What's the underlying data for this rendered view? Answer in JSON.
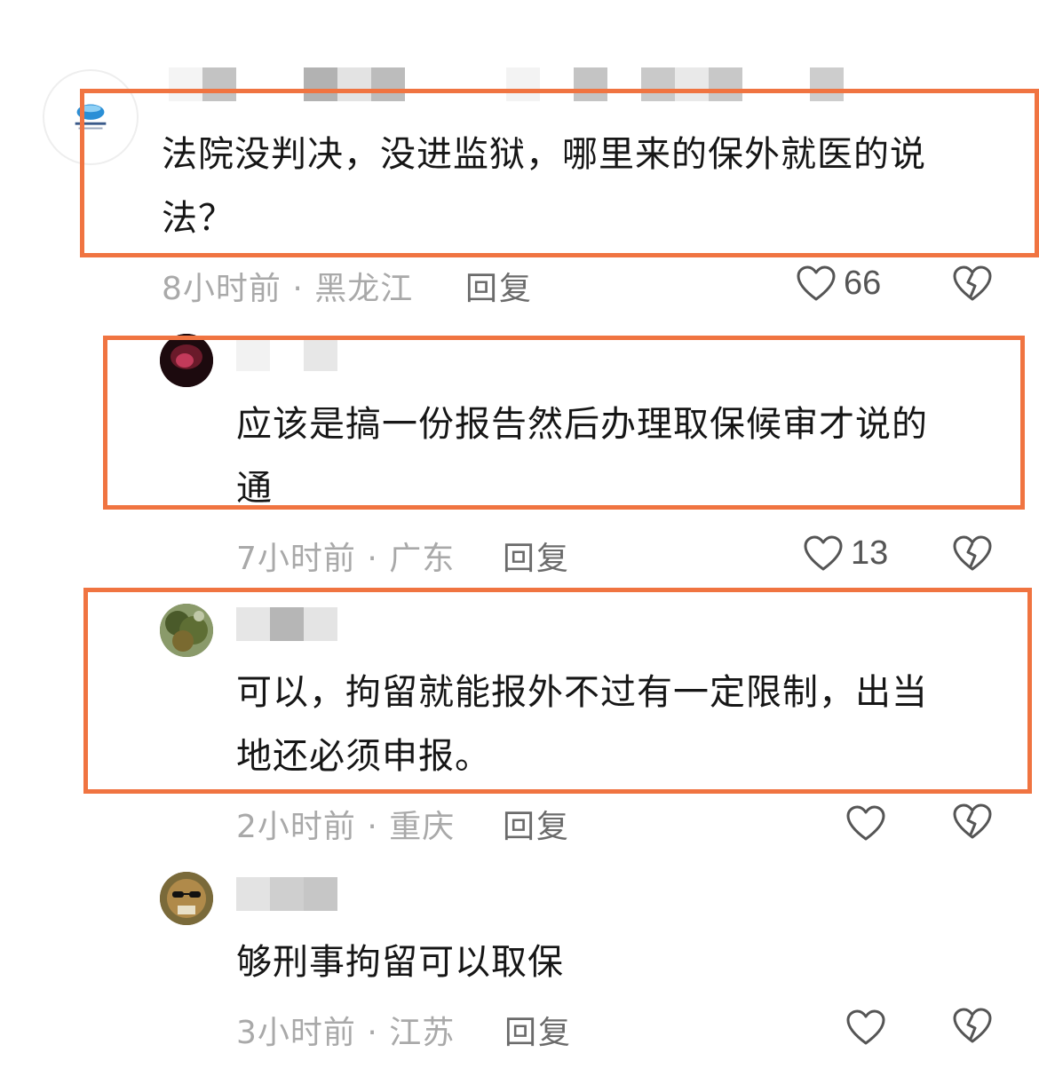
{
  "colors": {
    "highlight": "#f07441",
    "meta_text": "#a9a9a9",
    "body_text": "#161616",
    "icon_stroke": "#555555"
  },
  "comments": [
    {
      "text_lines": [
        "法院没判决，没进监狱，哪里来的保外就医的说",
        "法？"
      ],
      "meta": "8小时前 · 黑龙江",
      "reply_label": "回复",
      "like_count": "66",
      "avatar_icon": "news-logo-avatar",
      "highlighted": true
    },
    {
      "text_lines": [
        "应该是搞一份报告然后办理取保候审才说的",
        "通"
      ],
      "meta": "7小时前 · 广东",
      "reply_label": "回复",
      "like_count": "13",
      "avatar_icon": "dark-red-avatar",
      "highlighted": true
    },
    {
      "text_lines": [
        "可以，拘留就能报外不过有一定限制，出当",
        "地还必须申报。"
      ],
      "meta": "2小时前 · 重庆",
      "reply_label": "回复",
      "like_count": "",
      "avatar_icon": "tree-photo-avatar",
      "highlighted": true
    },
    {
      "text_lines": [
        "够刑事拘留可以取保"
      ],
      "meta": "3小时前 · 江苏",
      "reply_label": "回复",
      "like_count": "",
      "avatar_icon": "sunglasses-character-avatar",
      "highlighted": false
    }
  ],
  "icons": {
    "like": "heart-outline-icon",
    "dislike": "broken-heart-icon"
  }
}
